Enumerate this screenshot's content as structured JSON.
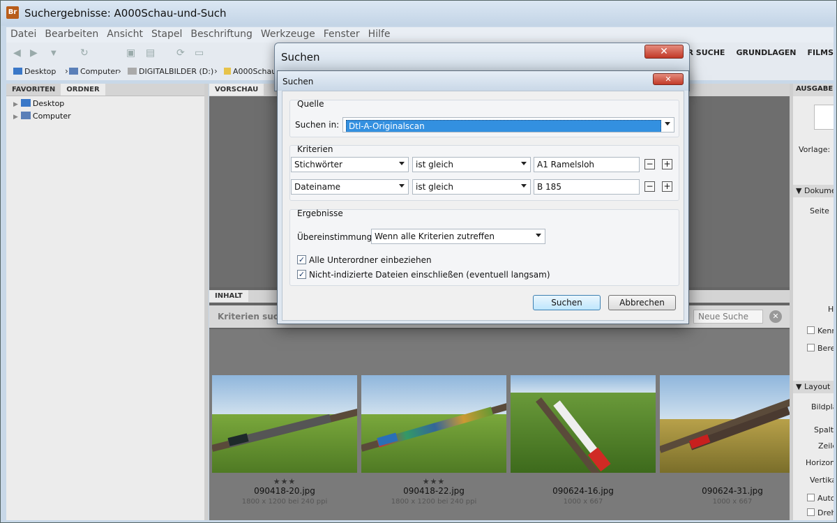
{
  "window": {
    "title": "Suchergebnisse: A000Schau-und-Such",
    "app_icon": "Br"
  },
  "menu": [
    "Datei",
    "Bearbeiten",
    "Ansicht",
    "Stapel",
    "Beschriftung",
    "Werkzeuge",
    "Fenster",
    "Hilfe"
  ],
  "workspaces": [
    "ZUR SUCHE",
    "GRUNDLAGEN",
    "FILMS"
  ],
  "path": {
    "desktop": "Desktop",
    "computer": "Computer",
    "drive": "DIGITALBILDER (D:)",
    "folder": "A000Schau"
  },
  "left_panel": {
    "tabs": [
      "FAVORITEN",
      "ORDNER"
    ],
    "tree": [
      "Desktop",
      "Computer"
    ]
  },
  "mid_panel": {
    "preview_tab": "VORSCHAU",
    "content_tab": "INHALT",
    "criteria_title": "Kriterien such",
    "new_search": "Neue Suche"
  },
  "thumbnails": [
    {
      "name": "090418-20.jpg",
      "size": "1800 x 1200 bei 240 ppi",
      "stars": "★★★",
      "locomotive_color": "#1e2a2a"
    },
    {
      "name": "090418-22.jpg",
      "size": "1800 x 1200 bei 240 ppi",
      "stars": "★★★",
      "locomotive_color": "#2a6fb8"
    },
    {
      "name": "090624-16.jpg",
      "size": "1000 x 667",
      "stars": "",
      "locomotive_color": "#d02a24"
    },
    {
      "name": "090624-31.jpg",
      "size": "1000 x 667",
      "stars": "",
      "locomotive_color": "#c8201e"
    }
  ],
  "right_panel": {
    "header": "AUSGABE",
    "vorlage": "Vorlage:",
    "dokument": "Dokumen",
    "seite": "Seite",
    "h": "H",
    "kenn": "Kenn",
    "bered": "Bered",
    "layout": "Layout",
    "bildplat": "Bildplat",
    "spalte": "Spalte",
    "zeile": "Zeile",
    "horizont": "Horizonta",
    "vertik": "Vertika",
    "autom": "Autom",
    "drehe": "Drehe"
  },
  "dialog_outer": {
    "title": "Suchen"
  },
  "dialog": {
    "title": "Suchen",
    "source_label": "Quelle",
    "search_in_label": "Suchen in:",
    "search_in_value": "Dtl-A-Originalscan",
    "criteria_label": "Kriterien",
    "criteria": [
      {
        "field": "Stichwörter",
        "operator": "ist gleich",
        "value": "A1 Ramelsloh"
      },
      {
        "field": "Dateiname",
        "operator": "ist gleich",
        "value": "B 185"
      }
    ],
    "results_label": "Ergebnisse",
    "match_label": "Übereinstimmung:",
    "match_value": "Wenn alle Kriterien zutreffen",
    "include_subfolders": "Alle Unterordner einbeziehen",
    "include_nonindexed": "Nicht-indizierte Dateien einschließen (eventuell langsam)",
    "search_button": "Suchen",
    "cancel_button": "Abbrechen"
  }
}
